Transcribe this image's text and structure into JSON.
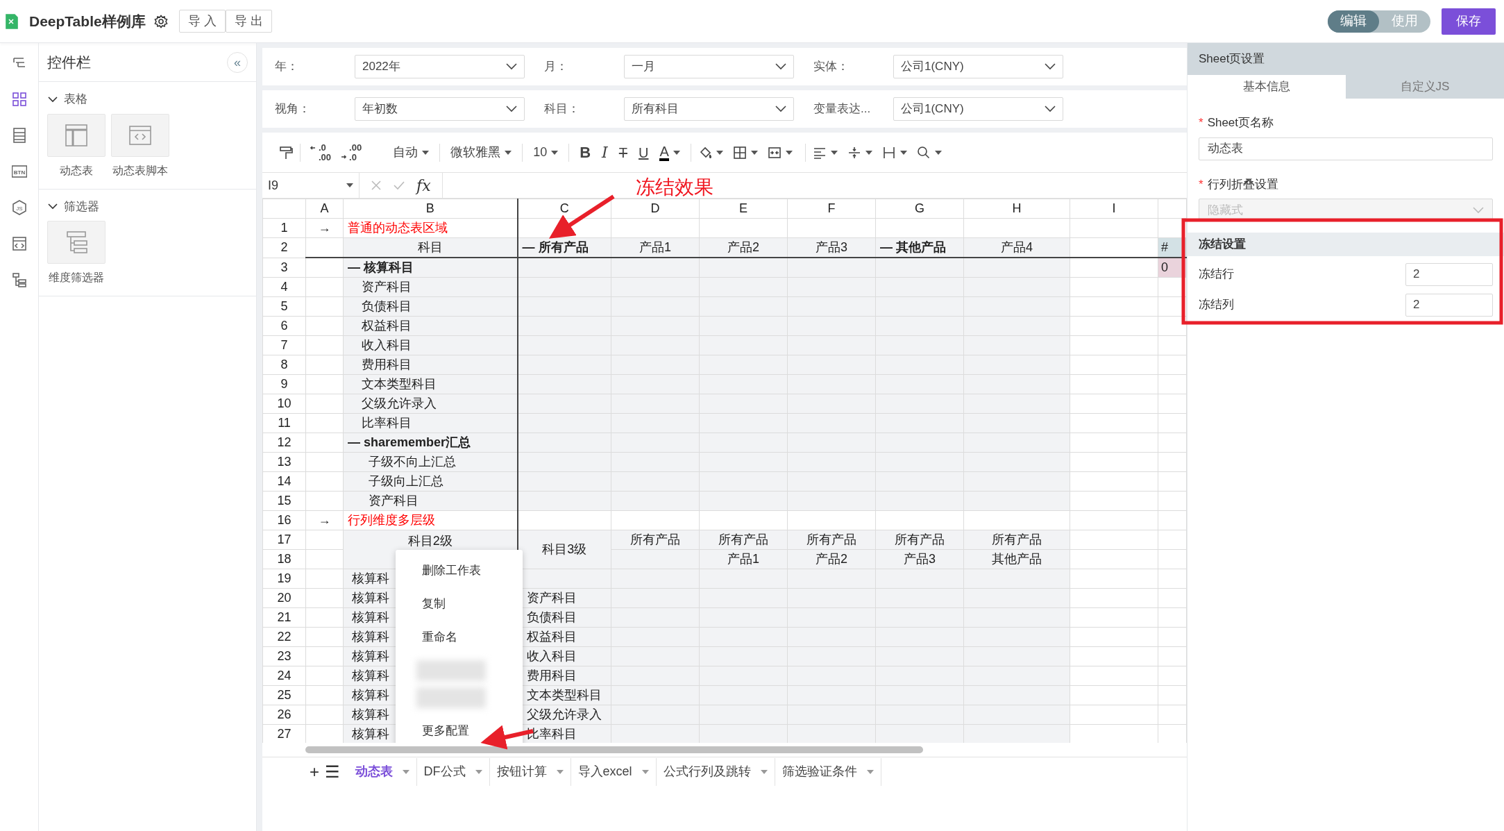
{
  "app": {
    "title": "DeepTable样例库",
    "actions": [
      "导 入",
      "导 出"
    ]
  },
  "mode_toggle": [
    {
      "label": "编辑",
      "selected": true
    },
    {
      "label": "使用",
      "selected": false
    }
  ],
  "save_button": "保存",
  "rail": [
    {
      "kind": "tree",
      "selected": false
    },
    {
      "kind": "grid",
      "selected": true
    },
    {
      "kind": "list",
      "selected": false
    },
    {
      "kind": "btn",
      "label": "BTN",
      "selected": false
    },
    {
      "kind": "js",
      "label": "JS",
      "selected": false
    },
    {
      "kind": "code",
      "selected": false
    },
    {
      "kind": "hierarchy",
      "selected": false
    }
  ],
  "widget_panel": {
    "title": "控件栏",
    "collapse": "«",
    "sections": [
      {
        "title": "表格",
        "expanded": true,
        "items": [
          {
            "label": "动态表",
            "kind": "table"
          },
          {
            "label": "动态表脚本",
            "kind": "script"
          }
        ]
      },
      {
        "title": "筛选器",
        "expanded": true,
        "items": [
          {
            "label": "维度筛选器",
            "kind": "filter"
          }
        ]
      }
    ]
  },
  "filters": [
    [
      {
        "label": "年：",
        "value": "2022年"
      },
      {
        "label": "月：",
        "value": "一月"
      },
      {
        "label": "实体：",
        "value": "公司1(CNY)"
      }
    ],
    [
      {
        "label": "视角：",
        "value": "年初数"
      },
      {
        "label": "科目：",
        "value": "所有科目"
      },
      {
        "label": "变量表达...",
        "value": "公司1(CNY)"
      }
    ]
  ],
  "toolbar": {
    "decrease_decimal": [
      ".0",
      ".00"
    ],
    "increase_decimal": [
      ".00",
      ".0"
    ],
    "number_format": "自动",
    "font": "微软雅黑",
    "font_size": "10",
    "bold": "B",
    "italic": "I",
    "strike": "T",
    "underline": "U",
    "font_color": "A"
  },
  "formula_bar": {
    "cell": "I9",
    "fx": "fx"
  },
  "sheet": {
    "columns": [
      "A",
      "B",
      "C",
      "D",
      "E",
      "F",
      "G",
      "H",
      "I"
    ],
    "rows": [
      {
        "number": "1",
        "shaded": false,
        "cells": [
          "→",
          {
            "text": "普通的动态表区域",
            "kind": "note"
          }
        ]
      },
      {
        "number": "2",
        "shaded": true,
        "cells": [
          "",
          "科目",
          {
            "text": "— 所有产品",
            "kind": "group"
          },
          "产品1",
          "产品2",
          "产品3",
          {
            "text": "— 其他产品",
            "kind": "group"
          },
          "产品4",
          "",
          {
            "text": "#",
            "kind": "marker",
            "color": "#d3e1e5"
          }
        ]
      },
      {
        "number": "3",
        "shaded": true,
        "cells": [
          "",
          {
            "text": "— 核算科目",
            "kind": "group"
          },
          "",
          "",
          "",
          "",
          "",
          "",
          "",
          {
            "text": "0",
            "kind": "marker",
            "color": "#ead3dc"
          }
        ]
      },
      {
        "number": "4",
        "shaded": true,
        "cells": [
          null,
          {
            "text": "资产科目",
            "kind": "sub"
          }
        ]
      },
      {
        "number": "5",
        "shaded": true,
        "cells": [
          null,
          {
            "text": "负债科目",
            "kind": "sub"
          }
        ]
      },
      {
        "number": "6",
        "shaded": true,
        "cells": [
          null,
          {
            "text": "权益科目",
            "kind": "sub"
          }
        ]
      },
      {
        "number": "7",
        "shaded": true,
        "cells": [
          null,
          {
            "text": "收入科目",
            "kind": "sub"
          }
        ]
      },
      {
        "number": "8",
        "shaded": true,
        "cells": [
          null,
          {
            "text": "费用科目",
            "kind": "sub"
          }
        ]
      },
      {
        "number": "9",
        "shaded": true,
        "cells": [
          null,
          {
            "text": "文本类型科目",
            "kind": "sub"
          }
        ]
      },
      {
        "number": "10",
        "shaded": true,
        "cells": [
          null,
          {
            "text": "父级允许录入",
            "kind": "sub"
          }
        ]
      },
      {
        "number": "11",
        "shaded": true,
        "cells": [
          null,
          {
            "text": "比率科目",
            "kind": "sub"
          }
        ]
      },
      {
        "number": "12",
        "shaded": true,
        "cells": [
          null,
          {
            "text": "— sharemember汇总",
            "kind": "group"
          }
        ]
      },
      {
        "number": "13",
        "shaded": true,
        "cells": [
          null,
          {
            "text": "子级不向上汇总",
            "kind": "sub2"
          }
        ]
      },
      {
        "number": "14",
        "shaded": true,
        "cells": [
          null,
          {
            "text": "子级向上汇总",
            "kind": "sub2"
          }
        ]
      },
      {
        "number": "15",
        "shaded": true,
        "cells": [
          null,
          {
            "text": "资产科目",
            "kind": "sub2"
          }
        ]
      },
      {
        "number": "16",
        "shaded": false,
        "cells": [
          "→",
          {
            "text": "行列维度多层级",
            "kind": "note"
          }
        ]
      },
      {
        "number": "17",
        "shaded": true,
        "cells": [
          "",
          {
            "text": "科目2级",
            "kind": "top",
            "rowspan": 2
          },
          {
            "text": "科目3级",
            "rowspan": 2
          },
          "所有产品",
          "所有产品",
          "所有产品",
          "所有产品",
          "所有产品"
        ]
      },
      {
        "number": "18",
        "shaded": true,
        "cells": [
          "",
          "",
          "产品1",
          "产品2",
          "产品3",
          "其他产品"
        ]
      },
      {
        "number": "19",
        "shaded": true,
        "cells": [
          null,
          {
            "text": "核算科",
            "kind": "item"
          }
        ]
      },
      {
        "number": "20",
        "shaded": true,
        "cells": [
          null,
          {
            "text": "核算科",
            "kind": "item"
          },
          {
            "text": "资产科目",
            "kind": "item"
          }
        ]
      },
      {
        "number": "21",
        "shaded": true,
        "cells": [
          null,
          {
            "text": "核算科",
            "kind": "item"
          },
          {
            "text": "负债科目",
            "kind": "item"
          }
        ]
      },
      {
        "number": "22",
        "shaded": true,
        "cells": [
          null,
          {
            "text": "核算科",
            "kind": "item"
          },
          {
            "text": "权益科目",
            "kind": "item"
          }
        ]
      },
      {
        "number": "23",
        "shaded": true,
        "cells": [
          null,
          {
            "text": "核算科",
            "kind": "item"
          },
          {
            "text": "收入科目",
            "kind": "item"
          }
        ]
      },
      {
        "number": "24",
        "shaded": true,
        "cells": [
          null,
          {
            "text": "核算科",
            "kind": "item"
          },
          {
            "text": "费用科目",
            "kind": "item"
          }
        ]
      },
      {
        "number": "25",
        "shaded": true,
        "cells": [
          null,
          {
            "text": "核算科",
            "kind": "item"
          },
          {
            "text": "文本类型科目",
            "kind": "item"
          }
        ]
      },
      {
        "number": "26",
        "shaded": true,
        "cells": [
          null,
          {
            "text": "核算科",
            "kind": "item"
          },
          {
            "text": "父级允许录入",
            "kind": "item"
          }
        ]
      },
      {
        "number": "27",
        "shaded": true,
        "cells": [
          null,
          {
            "text": "核算科",
            "kind": "item"
          },
          {
            "text": "比率科目",
            "kind": "item"
          }
        ]
      }
    ],
    "context_menu": [
      {
        "label": "删除工作表",
        "kind": "text"
      },
      {
        "label": "复制",
        "kind": "text"
      },
      {
        "label": "重命名",
        "kind": "text"
      },
      {
        "kind": "blurred"
      },
      {
        "kind": "blurred"
      },
      {
        "label": "更多配置",
        "kind": "text"
      }
    ],
    "add_sheet": "+",
    "sheet_list": "☰",
    "tabs": [
      {
        "label": "动态表",
        "selected": true
      },
      {
        "label": "DF公式",
        "selected": false
      },
      {
        "label": "按钮计算",
        "selected": false
      },
      {
        "label": "导入excel",
        "selected": false
      },
      {
        "label": "公式行列及跳转",
        "selected": false
      },
      {
        "label": "筛选验证条件",
        "selected": false
      }
    ]
  },
  "annotation": {
    "text": "冻结效果"
  },
  "settings": {
    "title": "Sheet页设置",
    "tabs": [
      {
        "label": "基本信息",
        "selected": true
      },
      {
        "label": "自定义JS",
        "selected": false
      }
    ],
    "fields": [
      {
        "label": "Sheet页名称",
        "required": true,
        "required_mark": "*",
        "kind": "input",
        "value": "动态表",
        "disabled": false
      },
      {
        "label": "行列折叠设置",
        "required": true,
        "required_mark": "*",
        "kind": "select",
        "value": "隐藏式",
        "disabled": true
      }
    ],
    "freeze": {
      "title": "冻结设置",
      "rows_label": "冻结行",
      "rows_value": "2",
      "cols_label": "冻结列",
      "cols_value": "2"
    }
  }
}
